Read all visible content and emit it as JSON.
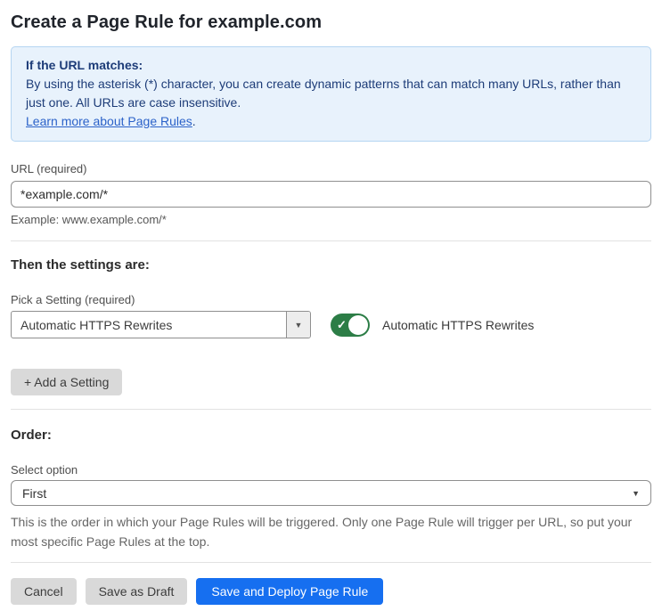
{
  "page": {
    "title": "Create a Page Rule for example.com"
  },
  "info_box": {
    "heading": "If the URL matches:",
    "body": "By using the asterisk (*) character, you can create dynamic patterns that can match many URLs, rather than just one. All URLs are case insensitive.",
    "link_label": "Learn more about Page Rules",
    "link_suffix": "."
  },
  "url_field": {
    "label": "URL (required)",
    "value": "*example.com/*",
    "hint": "Example: www.example.com/*"
  },
  "settings": {
    "heading": "Then the settings are:",
    "pick_label": "Pick a Setting (required)",
    "dropdown_value": "Automatic HTTPS Rewrites",
    "toggle_label": "Automatic HTTPS Rewrites",
    "toggle_state": "on",
    "add_button_label": "+ Add a Setting"
  },
  "order": {
    "heading": "Order:",
    "label": "Select option",
    "selected_option": "First",
    "hint": "This is the order in which your Page Rules will be triggered. Only one Page Rule will trigger per URL, so put your most specific Page Rules at the top."
  },
  "actions": {
    "cancel_label": "Cancel",
    "save_draft_label": "Save as Draft",
    "save_deploy_label": "Save and Deploy Page Rule"
  },
  "icons": {
    "dropdown_arrow": "▼",
    "select_arrow": "▼",
    "toggle_check": "✓"
  },
  "colors": {
    "info_bg": "#e8f2fc",
    "info_border": "#b5d5f2",
    "info_text": "#1d3c78",
    "link": "#2b62c9",
    "toggle_on": "#2c7d46",
    "primary_button": "#166ff0",
    "secondary_button": "#d9d9d9"
  }
}
